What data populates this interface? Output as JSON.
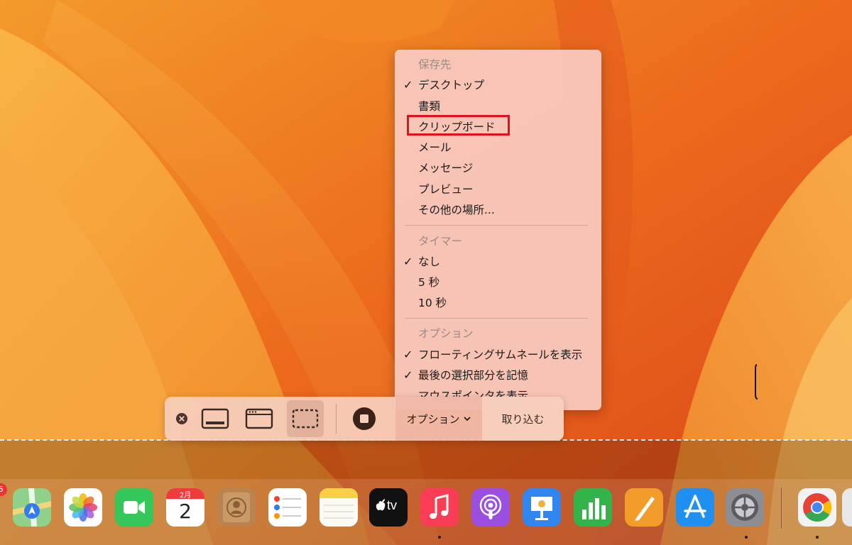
{
  "toolbar": {
    "options_label": "オプション",
    "capture_label": "取り込む"
  },
  "menu": {
    "save_header": "保存先",
    "save_items": [
      {
        "label": "デスクトップ",
        "checked": true
      },
      {
        "label": "書類",
        "checked": false
      },
      {
        "label": "クリップボード",
        "checked": false,
        "highlighted": true
      },
      {
        "label": "メール",
        "checked": false
      },
      {
        "label": "メッセージ",
        "checked": false
      },
      {
        "label": "プレビュー",
        "checked": false
      },
      {
        "label": "その他の場所...",
        "checked": false
      }
    ],
    "timer_header": "タイマー",
    "timer_items": [
      {
        "label": "なし",
        "checked": true
      },
      {
        "label": "5 秒",
        "checked": false
      },
      {
        "label": "10 秒",
        "checked": false
      }
    ],
    "options_header": "オプション",
    "options_items": [
      {
        "label": "フローティングサムネールを表示",
        "checked": true
      },
      {
        "label": "最後の選択部分を記憶",
        "checked": true
      },
      {
        "label": "マウスポインタを表示",
        "checked": false
      }
    ]
  },
  "dock": {
    "calendar_month": "2月",
    "calendar_day": "2",
    "tv_label": "tv",
    "badge_count": "6",
    "apps": [
      "maps-icon",
      "photos-icon",
      "facetime-icon",
      "calendar-icon",
      "contacts-icon",
      "reminders-icon",
      "notes-icon",
      "tv-icon",
      "music-icon",
      "podcasts-icon",
      "keynote-icon",
      "numbers-icon",
      "pages-icon",
      "app-store-icon",
      "system-settings-icon",
      "chrome-icon"
    ]
  },
  "colors": {
    "highlight_box": "#e0101f",
    "wallpaper_base": "#e8661c"
  }
}
